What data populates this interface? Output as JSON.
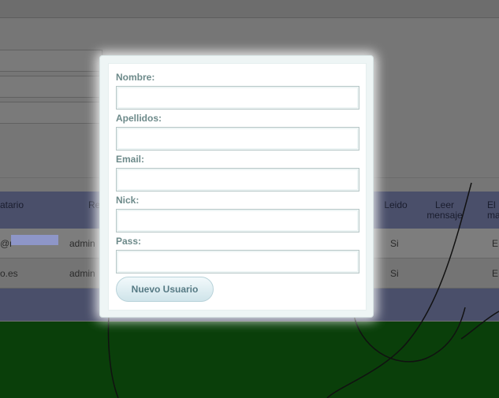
{
  "background": {
    "table": {
      "headers": [
        "atario",
        "Re",
        "Leido",
        "Leer mensaje",
        "El ma"
      ],
      "rows": [
        {
          "destinatario": "@r",
          "remitente": "admin",
          "leido": "Si",
          "accion": "E"
        },
        {
          "destinatario": "o.es",
          "remitente": "admin",
          "leido": "Si",
          "accion": "E"
        }
      ]
    }
  },
  "modal": {
    "fields": [
      {
        "label": "Nombre:",
        "value": "",
        "placeholder": ""
      },
      {
        "label": "Apellidos:",
        "value": "",
        "placeholder": ""
      },
      {
        "label": "Email:",
        "value": "",
        "placeholder": ""
      },
      {
        "label": "Nick:",
        "value": "",
        "placeholder": ""
      },
      {
        "label": "Pass:",
        "value": "",
        "placeholder": ""
      }
    ],
    "submit_label": "Nuevo Usuario"
  },
  "colors": {
    "overlay": "#6f6f6f",
    "label": "#6d8a8a",
    "button_text": "#567a84",
    "table_header": "#4a4f6a",
    "bottom_area": "#0a3f0a"
  }
}
